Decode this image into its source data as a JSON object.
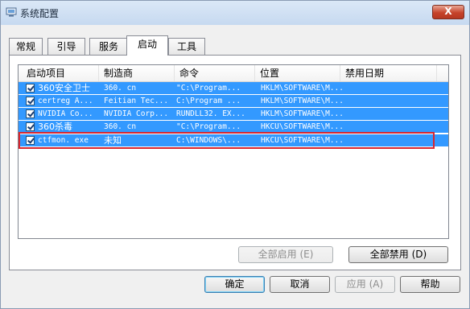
{
  "window": {
    "title": "系统配置",
    "title_icon": "system-config-icon",
    "close_icon": "close-icon",
    "close_label": "X"
  },
  "tabs": [
    {
      "label": "常规",
      "active": false
    },
    {
      "label": "引导",
      "active": false
    },
    {
      "label": "服务",
      "active": false
    },
    {
      "label": "启动",
      "active": true
    },
    {
      "label": "工具",
      "active": false
    }
  ],
  "startup": {
    "columns": [
      "启动项目",
      "制造商",
      "命令",
      "位置",
      "禁用日期"
    ],
    "rows": [
      {
        "checked": true,
        "item": "360安全卫士",
        "maker": "360. cn",
        "command": "\"C:\\Program...",
        "location": "HKLM\\SOFTWARE\\M...",
        "date": ""
      },
      {
        "checked": true,
        "item": "certreg A...",
        "maker": "Feitian Tec...",
        "command": "C:\\Program ...",
        "location": "HKLM\\SOFTWARE\\M...",
        "date": ""
      },
      {
        "checked": true,
        "item": "NVIDIA Co...",
        "maker": "NVIDIA Corp...",
        "command": "RUNDLL32. EX...",
        "location": "HKLM\\SOFTWARE\\M...",
        "date": ""
      },
      {
        "checked": true,
        "item": "360杀毒",
        "maker": "360. cn",
        "command": "\"C:\\Program...",
        "location": "HKCU\\SOFTWARE\\M...",
        "date": ""
      },
      {
        "checked": true,
        "item": "ctfmon. exe",
        "maker": "未知",
        "command": "C:\\WINDOWS\\...",
        "location": "HKCU\\SOFTWARE\\M...",
        "date": ""
      }
    ],
    "highlighted_row": 4
  },
  "buttons": {
    "enable_all": {
      "label": "全部启用",
      "key": "(E)",
      "enabled": false
    },
    "disable_all": {
      "label": "全部禁用",
      "key": "(D)",
      "enabled": true
    },
    "ok": {
      "label": "确定",
      "enabled": true
    },
    "cancel": {
      "label": "取消",
      "enabled": true
    },
    "apply": {
      "label": "应用",
      "key": "(A)",
      "enabled": false
    },
    "help": {
      "label": "帮助",
      "enabled": true
    }
  },
  "colors": {
    "selection": "#3399ff",
    "highlight_border": "#d8262f"
  }
}
